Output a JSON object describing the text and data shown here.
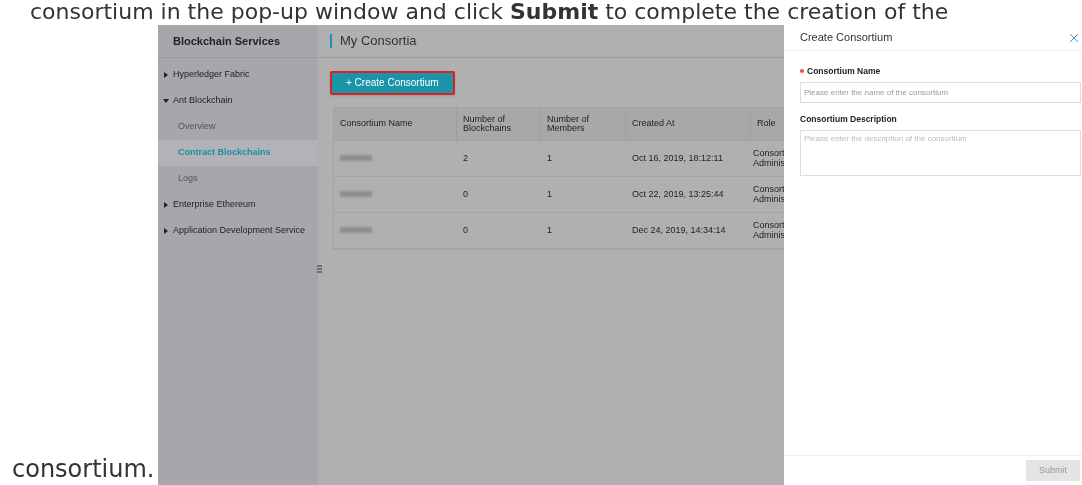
{
  "doc_text": {
    "before": "consortium in the pop-up window and click **Submit** to complete the creation of the",
    "after": "consortium."
  },
  "sidebar": {
    "title": "Blockchain Services",
    "items": [
      {
        "label": "Hyperledger Fabric",
        "expanded": false,
        "selected": false
      },
      {
        "label": "Ant Blockchain",
        "expanded": true,
        "selected": false,
        "children": [
          {
            "label": "Overview",
            "selected": false
          },
          {
            "label": "Contract Blockchains",
            "selected": true
          },
          {
            "label": "Logs",
            "selected": false
          }
        ]
      },
      {
        "label": "Enterprise Ethereum",
        "expanded": false,
        "selected": false
      },
      {
        "label": "Application Development Service",
        "expanded": false,
        "selected": false
      }
    ]
  },
  "main": {
    "title": "My Consortia",
    "create_button": "+ Create Consortium",
    "table": {
      "columns": [
        "Consortium Name",
        "Number of Blockchains",
        "Number of Members",
        "Created At",
        "Role"
      ],
      "rows": [
        {
          "blockchains": "2",
          "members": "1",
          "created_at": "Oct 16, 2019, 18:12:11",
          "role": "Consort Adminis"
        },
        {
          "blockchains": "0",
          "members": "1",
          "created_at": "Oct 22, 2019, 13:25:44",
          "role": "Consort Adminis"
        },
        {
          "blockchains": "0",
          "members": "1",
          "created_at": "Dec 24, 2019, 14:34:14",
          "role": "Consort Adminis"
        }
      ]
    }
  },
  "drawer": {
    "title": "Create Consortium",
    "fields": [
      {
        "kind": "input",
        "label": "Consortium Name",
        "required": true,
        "placeholder": "Please enter the name of the consortium"
      },
      {
        "kind": "textarea",
        "label": "Consortium Description",
        "required": false,
        "placeholder": "Please enter the description of the consortium"
      }
    ],
    "submit": {
      "label": "Submit",
      "disabled": true
    }
  }
}
